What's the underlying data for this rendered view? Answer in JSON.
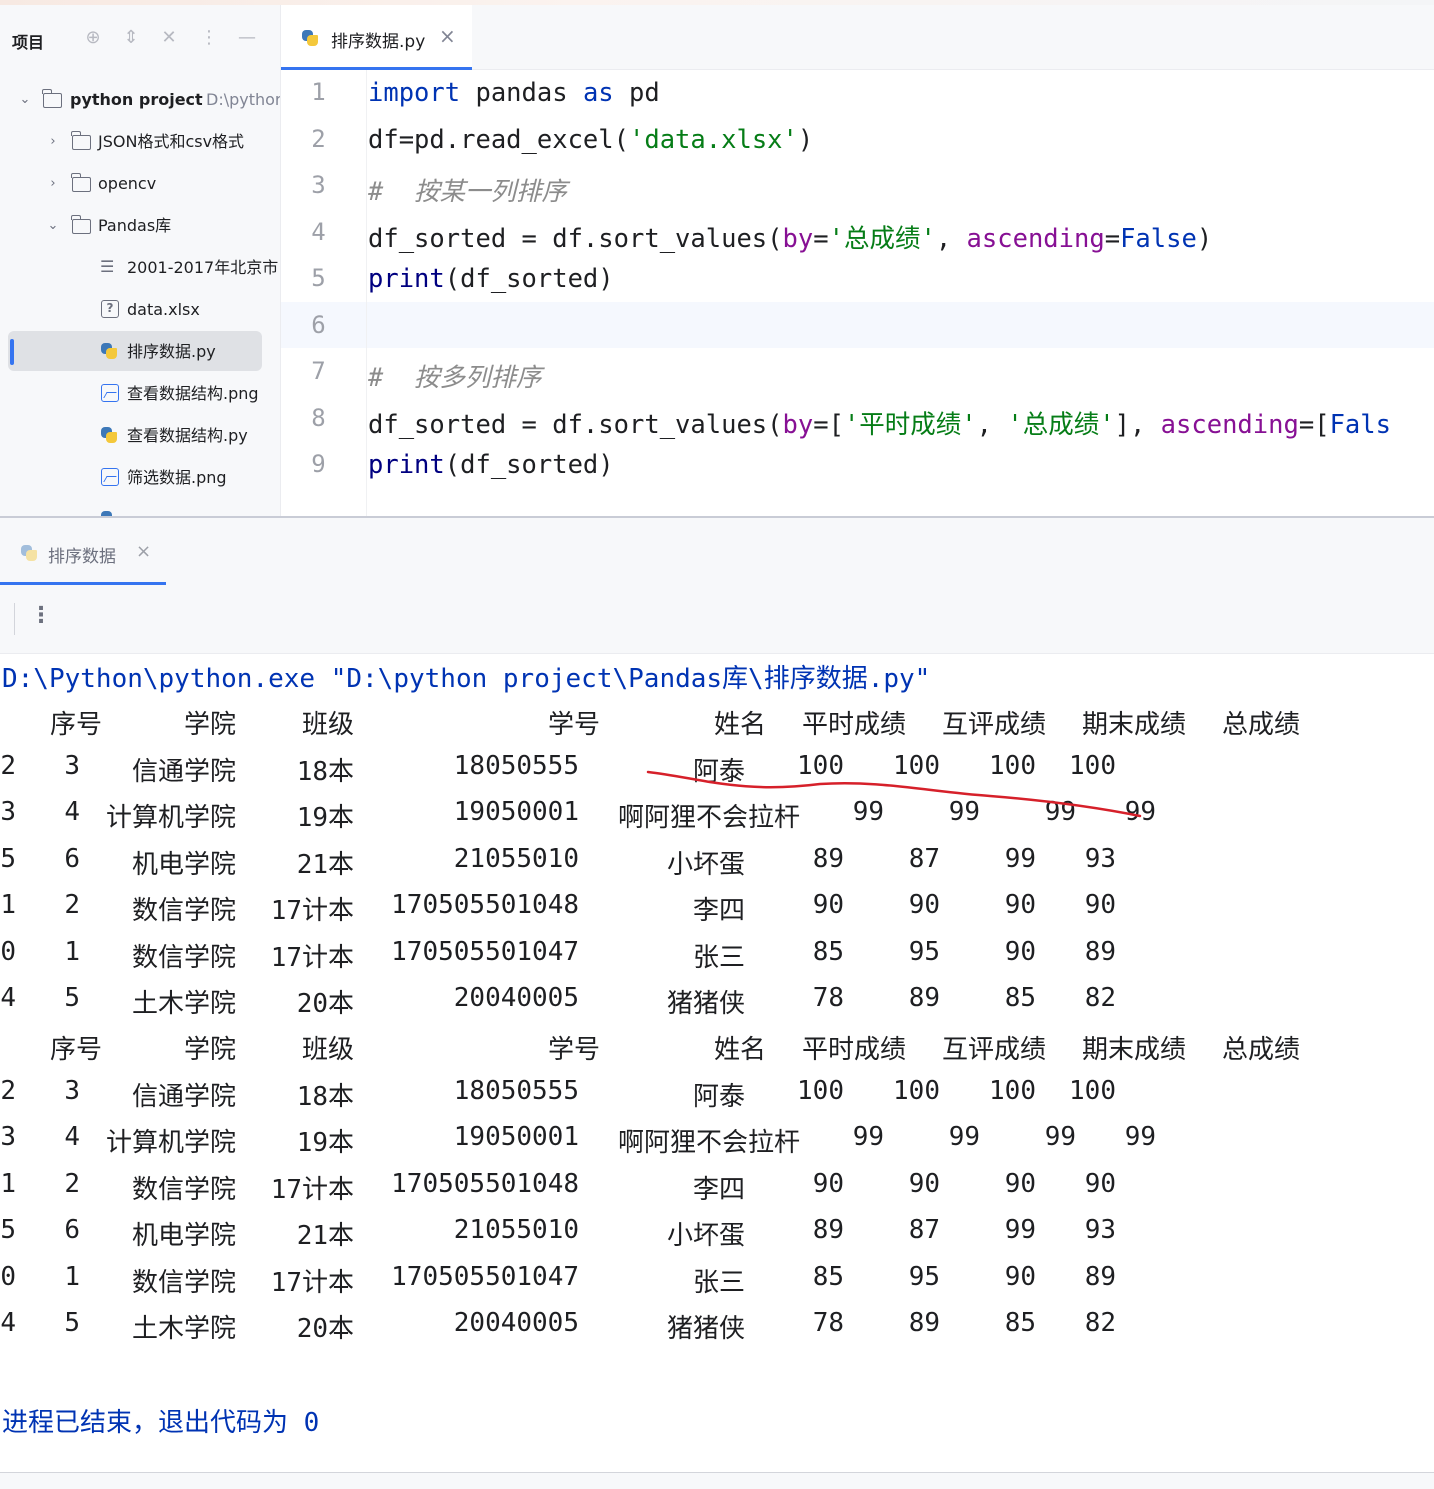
{
  "project": {
    "title": "项目",
    "root_name": "python project",
    "root_path": "D:\\pythor",
    "items": [
      {
        "label": "JSON格式和csv格式",
        "type": "folder",
        "expanded": false
      },
      {
        "label": "opencv",
        "type": "folder",
        "expanded": false
      },
      {
        "label": "Pandas库",
        "type": "folder",
        "expanded": true
      },
      {
        "label": "2001-2017年北京市",
        "type": "text-file"
      },
      {
        "label": "data.xlsx",
        "type": "unknown-file"
      },
      {
        "label": "排序数据.py",
        "type": "python-file",
        "selected": true
      },
      {
        "label": "查看数据结构.png",
        "type": "image-file"
      },
      {
        "label": "查看数据结构.py",
        "type": "python-file"
      },
      {
        "label": "筛选数据.png",
        "type": "image-file"
      }
    ]
  },
  "editor": {
    "tab_label": "排序数据.py",
    "line_numbers": [
      "1",
      "2",
      "3",
      "4",
      "5",
      "6",
      "7",
      "8",
      "9"
    ],
    "lines": [
      [
        {
          "t": "import",
          "c": "kw"
        },
        {
          "t": " pandas ",
          "c": ""
        },
        {
          "t": "as",
          "c": "kw"
        },
        {
          "t": " pd",
          "c": ""
        }
      ],
      [
        {
          "t": "df=pd.read_excel(",
          "c": ""
        },
        {
          "t": "'data.xlsx'",
          "c": "str"
        },
        {
          "t": ")",
          "c": ""
        }
      ],
      [
        {
          "t": "#  按某一列排序",
          "c": "cmt"
        }
      ],
      [
        {
          "t": "df_sorted = df.sort_values(",
          "c": ""
        },
        {
          "t": "by",
          "c": "kwarg"
        },
        {
          "t": "=",
          "c": ""
        },
        {
          "t": "'总成绩'",
          "c": "str"
        },
        {
          "t": ", ",
          "c": ""
        },
        {
          "t": "ascending",
          "c": "kwarg"
        },
        {
          "t": "=",
          "c": ""
        },
        {
          "t": "False",
          "c": "kw"
        },
        {
          "t": ")",
          "c": ""
        }
      ],
      [
        {
          "t": "print",
          "c": "bi"
        },
        {
          "t": "(df_sorted)",
          "c": ""
        }
      ],
      [],
      [
        {
          "t": "#  按多列排序",
          "c": "cmt"
        }
      ],
      [
        {
          "t": "df_sorted = df.sort_values(",
          "c": ""
        },
        {
          "t": "by",
          "c": "kwarg"
        },
        {
          "t": "=[",
          "c": ""
        },
        {
          "t": "'平时成绩'",
          "c": "str"
        },
        {
          "t": ", ",
          "c": ""
        },
        {
          "t": "'总成绩'",
          "c": "str"
        },
        {
          "t": "], ",
          "c": ""
        },
        {
          "t": "ascending",
          "c": "kwarg"
        },
        {
          "t": "=[",
          "c": ""
        },
        {
          "t": "Fals",
          "c": "kw"
        }
      ],
      [
        {
          "t": "print",
          "c": "bi"
        },
        {
          "t": "(df_sorted)",
          "c": ""
        }
      ]
    ]
  },
  "run": {
    "tab_label": "排序数据",
    "command": "D:\\Python\\python.exe \"D:\\python project\\Pandas库\\排序数据.py\"",
    "headers": [
      "序号",
      "学院",
      "班级",
      "学号",
      "姓名",
      "平时成绩",
      "互评成绩",
      "期末成绩",
      "总成绩"
    ],
    "table1": [
      [
        "2",
        "3",
        "信通学院",
        "18本",
        "18050555",
        "阿泰",
        "100",
        "100",
        "100",
        "100"
      ],
      [
        "3",
        "4",
        "计算机学院",
        "19本",
        "19050001",
        "啊阿狸不会拉杆",
        "99",
        "99",
        "99",
        "99"
      ],
      [
        "5",
        "6",
        "机电学院",
        "21本",
        "21055010",
        "小坏蛋",
        "89",
        "87",
        "99",
        "93"
      ],
      [
        "1",
        "2",
        "数信学院",
        "17计本",
        "170505501048",
        "李四",
        "90",
        "90",
        "90",
        "90"
      ],
      [
        "0",
        "1",
        "数信学院",
        "17计本",
        "170505501047",
        "张三",
        "85",
        "95",
        "90",
        "89"
      ],
      [
        "4",
        "5",
        "土木学院",
        "20本",
        "20040005",
        "猪猪侠",
        "78",
        "89",
        "85",
        "82"
      ]
    ],
    "table2": [
      [
        "2",
        "3",
        "信通学院",
        "18本",
        "18050555",
        "阿泰",
        "100",
        "100",
        "100",
        "100"
      ],
      [
        "3",
        "4",
        "计算机学院",
        "19本",
        "19050001",
        "啊阿狸不会拉杆",
        "99",
        "99",
        "99",
        "99"
      ],
      [
        "1",
        "2",
        "数信学院",
        "17计本",
        "170505501048",
        "李四",
        "90",
        "90",
        "90",
        "90"
      ],
      [
        "5",
        "6",
        "机电学院",
        "21本",
        "21055010",
        "小坏蛋",
        "89",
        "87",
        "99",
        "93"
      ],
      [
        "0",
        "1",
        "数信学院",
        "17计本",
        "170505501047",
        "张三",
        "85",
        "95",
        "90",
        "89"
      ],
      [
        "4",
        "5",
        "土木学院",
        "20本",
        "20040005",
        "猪猪侠",
        "78",
        "89",
        "85",
        "82"
      ]
    ],
    "exit_message": "进程已结束，退出代码为 0"
  },
  "colors": {
    "accent": "#3574f0",
    "annotation": "#d6202a",
    "keyword": "#0033b3",
    "string": "#067d17"
  }
}
